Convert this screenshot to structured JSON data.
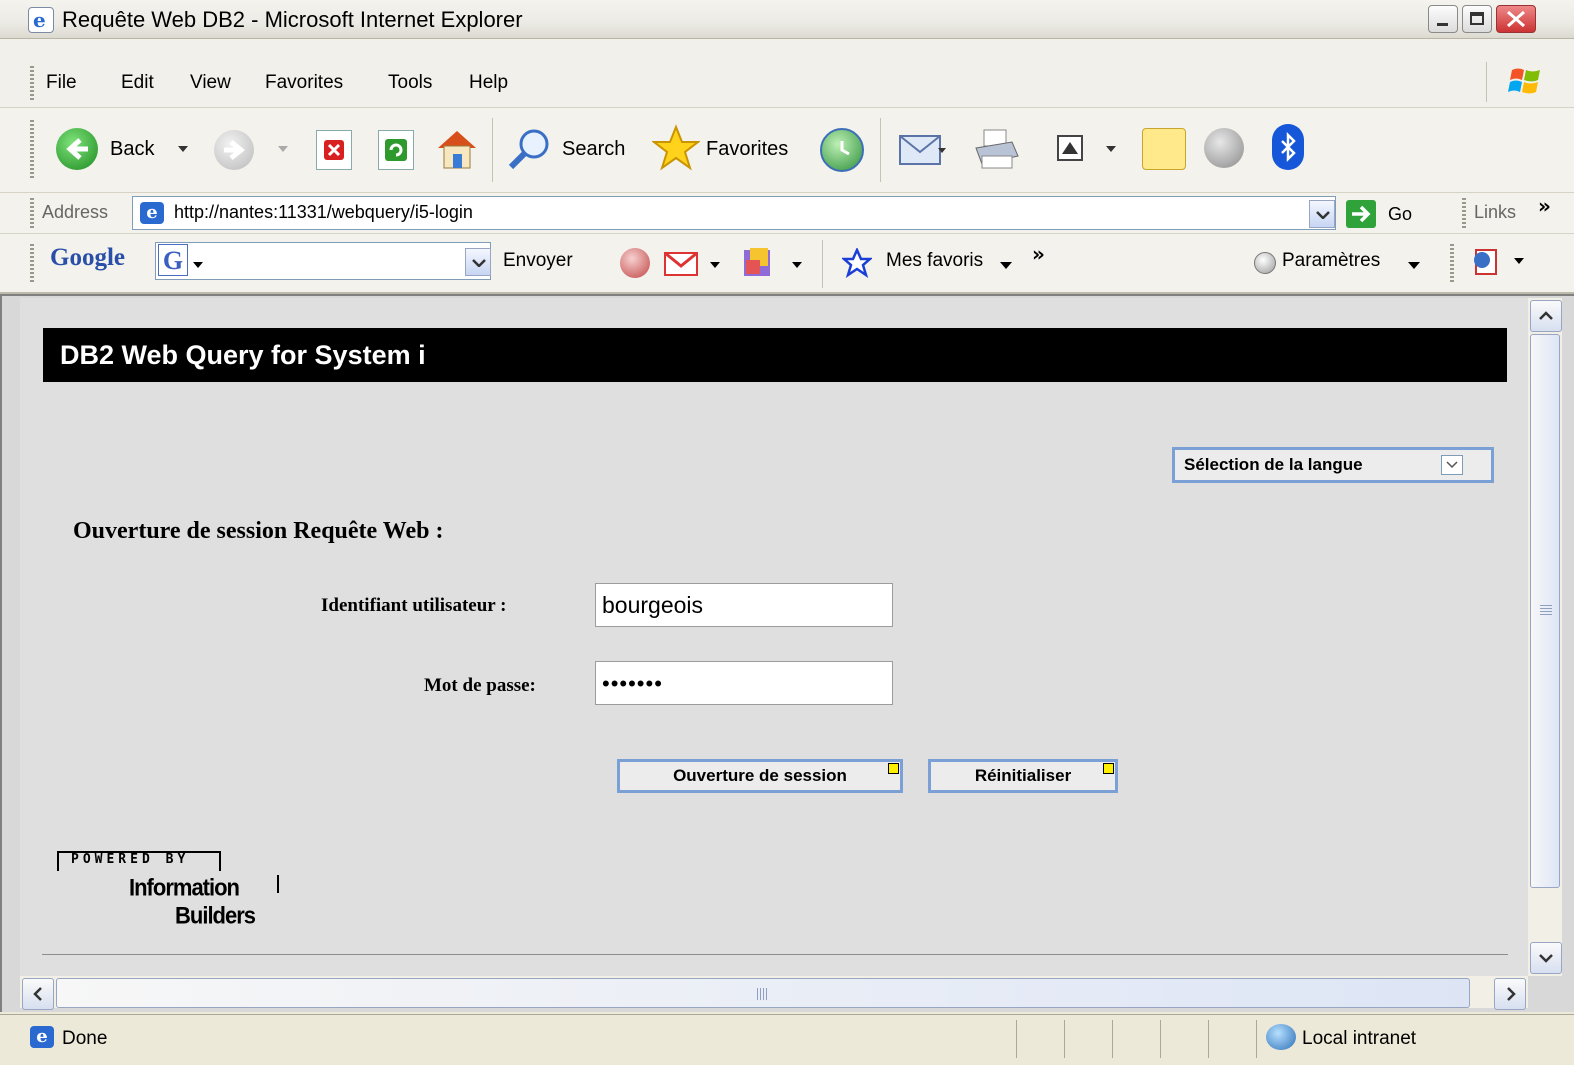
{
  "window": {
    "title": "Requête Web DB2 - Microsoft Internet Explorer"
  },
  "menu": [
    "File",
    "Edit",
    "View",
    "Favorites",
    "Tools",
    "Help"
  ],
  "toolbar": {
    "back_label": "Back",
    "search_label": "Search",
    "favorites_label": "Favorites"
  },
  "address": {
    "label": "Address",
    "url": "http://nantes:11331/webquery/i5-login",
    "go_label": "Go",
    "links_label": "Links"
  },
  "google": {
    "logo": "Google",
    "send_label": "Envoyer",
    "favs_label": "Mes favoris",
    "params_label": "Paramètres"
  },
  "page": {
    "header": "DB2 Web Query for System i",
    "language_select": "Sélection de la langue",
    "session_title": "Ouverture de session Requête Web :",
    "user_label": "Identifiant utilisateur :",
    "user_value": "bourgeois",
    "password_label": "Mot de passe:",
    "password_value": "•••••••",
    "login_button": "Ouverture de session",
    "reset_button": "Réinitialiser",
    "powered_by": "POWERED BY",
    "brand_line1": "Information",
    "brand_line2": "Builders"
  },
  "status": {
    "text": "Done",
    "zone": "Local intranet"
  },
  "icons": {
    "window_icon": "ie-icon",
    "back": "back-arrow-icon",
    "forward": "forward-arrow-icon",
    "stop": "stop-icon",
    "refresh": "refresh-icon",
    "home": "home-icon",
    "search": "search-icon",
    "favorites": "star-icon",
    "history": "history-icon",
    "mail": "mail-icon",
    "print": "print-icon"
  }
}
